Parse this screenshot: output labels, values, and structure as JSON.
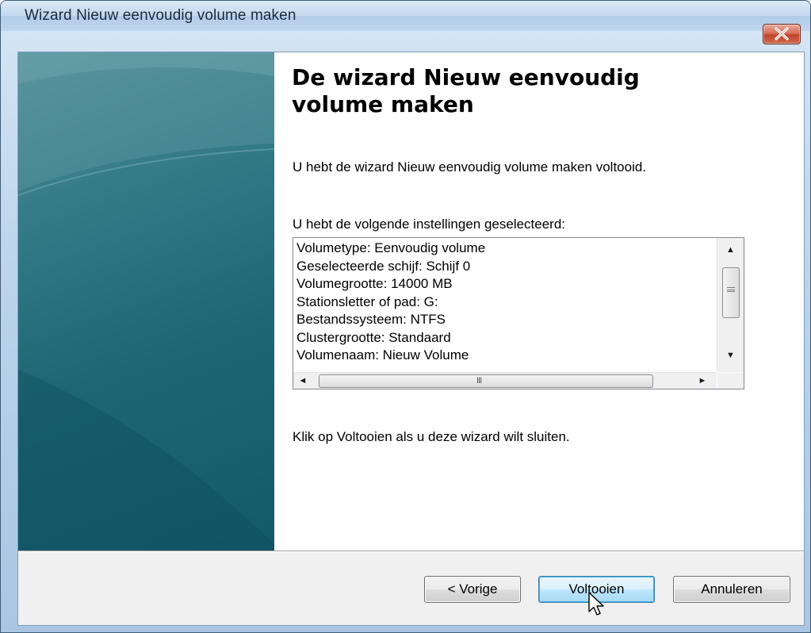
{
  "window": {
    "title": "Wizard Nieuw eenvoudig volume maken"
  },
  "main": {
    "heading": "De wizard Nieuw eenvoudig volume maken",
    "completed_message": "U hebt de wizard Nieuw eenvoudig volume maken voltooid.",
    "settings_label": "U hebt de volgende instellingen geselecteerd:",
    "settings": [
      "Volumetype: Eenvoudig volume",
      "Geselecteerde schijf: Schijf 0",
      "Volumegrootte: 14000 MB",
      "Stationsletter of pad: G:",
      "Bestandssysteem: NTFS",
      "Clustergrootte: Standaard",
      "Volumenaam: Nieuw Volume"
    ],
    "finish_instruction": "Klik op Voltooien als u deze wizard wilt sluiten."
  },
  "buttons": {
    "back": "< Vorige",
    "finish": "Voltooien",
    "cancel": "Annuleren"
  },
  "scrollbar": {
    "up_glyph": "▲",
    "down_glyph": "▼",
    "left_glyph": "◄",
    "right_glyph": "►",
    "grip_glyph": "III"
  },
  "colors": {
    "title_bar": "#c3d8ef",
    "side_panel": "#1f6674",
    "close_button": "#c0452b",
    "focused_button_border": "#3c7fb1"
  },
  "icons": {
    "close": "close-icon",
    "cursor": "mouse-pointer-icon"
  }
}
